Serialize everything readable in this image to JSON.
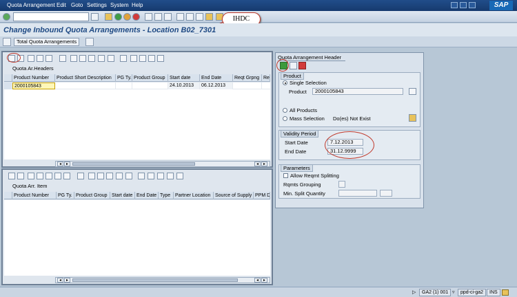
{
  "menu": [
    "Quota Arrangement",
    "Edit",
    "Goto",
    "Settings",
    "System",
    "Help"
  ],
  "brand": "SAP",
  "title": "Change Inbound Quota Arrangements - Location B02_7301",
  "callout": "IHDC",
  "app_toolbar": {
    "total_button": "Total Quota Arrangements"
  },
  "headers_panel": {
    "label": "Quota Ar.Headers",
    "columns": [
      "Product Number",
      "Product Short Description",
      "PG Ty.",
      "Product Group",
      "Start date",
      "End Date",
      "Reqt Grpng",
      "Re"
    ],
    "rows": [
      {
        "product": "2000105843",
        "desc": "",
        "pgty": "",
        "pgroup": "",
        "start": "24.10.2013",
        "end": "06.12.2013",
        "reqt": ""
      }
    ]
  },
  "items_panel": {
    "label": "Quota Arr. Item",
    "columns": [
      "Product Number",
      "PG Ty.",
      "Product Group",
      "Start date",
      "End Date",
      "Type",
      "Partner Location",
      "Source of Supply",
      "PPM De"
    ]
  },
  "right_panel": {
    "header_tab": "Quota Arrangement Header",
    "product_group": "Product",
    "single_selection": "Single Selection",
    "product_label": "Product",
    "product_value": "2000105843",
    "all_products": "All Products",
    "mass_selection": "Mass Selection",
    "mass_status": "Do(es) Not Exist",
    "validity_group": "Validity Period",
    "start_label": "Start Date",
    "start_value": "7.12.2013",
    "end_label": "End Date",
    "end_value": "31.12.9999",
    "params_group": "Parameters",
    "allow_split": "Allow Reqmt Splitting",
    "rqmts_grouping": "Rqmts Grouping",
    "min_split": "Min. Split Quantity"
  },
  "status": {
    "system": "GA2 (1) 001",
    "server": "ppd-ci-ga2",
    "mode": "INS"
  }
}
